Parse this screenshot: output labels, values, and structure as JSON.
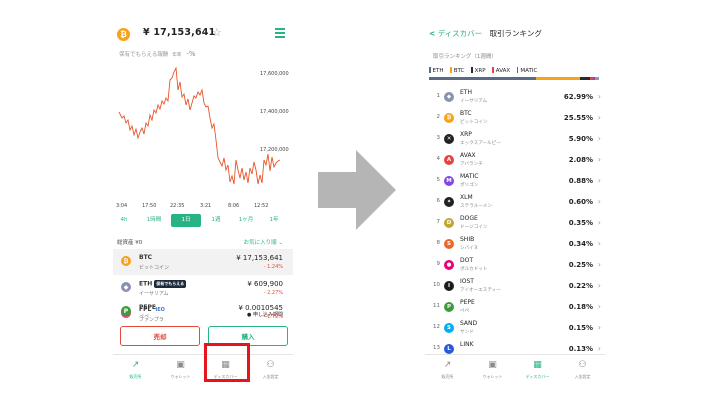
{
  "left": {
    "header": {
      "coin_symbol": "₿",
      "price": "¥ 17,153,641",
      "star": "☆",
      "reward_label": "保有でもらえる報酬",
      "reward_sub": "年率",
      "reward_pct": "-%"
    },
    "chart": {
      "y_labels": [
        "17,600,000",
        "17,400,000",
        "17,200,000"
      ],
      "x_labels": [
        "3:04",
        "17:50",
        "22:35",
        "3:21",
        "8:06",
        "12:52"
      ],
      "color": "#e8542b"
    },
    "timeframes": [
      "4h",
      "1時間",
      "1日",
      "1週",
      "1ヶ月",
      "1年"
    ],
    "active_timeframe": "1日",
    "balance_label": "総資産 ¥0",
    "favorite_label": "お気に入り順 ⌄",
    "assets": [
      {
        "symbol": "BTC",
        "name": "ビットコイン",
        "price": "¥ 17,153,641",
        "change": "- 1.24%",
        "icon": "₿",
        "color": "#f7a21b"
      },
      {
        "symbol": "ETH",
        "tag": "保有でもらえる",
        "name": "イーサリアム",
        "price": "¥ 609,900",
        "change": "- 2.27%",
        "icon": "◆",
        "color": "#8a92b2"
      },
      {
        "symbol": "FPL",
        "ieo": "IEO",
        "name": "ファンプラ",
        "price": "● 申し込み期間",
        "change": "",
        "icon": "F",
        "color": "#e0457b"
      },
      {
        "symbol": "PEPE",
        "name": "ペペ",
        "price": "¥ 0.0010545",
        "change": "- 1.72%",
        "icon": "P",
        "color": "#3e9b3c"
      }
    ],
    "sell_label": "売却",
    "buy_label": "購入"
  },
  "nav": [
    {
      "label": "販売所",
      "icon": "↗"
    },
    {
      "label": "ウォレット",
      "icon": "▣"
    },
    {
      "label": "ディスカバー",
      "icon": "▦"
    },
    {
      "label": "入金設定",
      "icon": "⚇"
    }
  ],
  "right": {
    "back": "<",
    "discover": "ディスカバー",
    "title": "取引ランキング",
    "sub": "取引ランキング（1週間）",
    "legend": [
      {
        "label": "ETH",
        "color": "#5b6b85"
      },
      {
        "label": "BTC",
        "color": "#f7a21b"
      },
      {
        "label": "XRP",
        "color": "#2b2b2b"
      },
      {
        "label": "AVAX",
        "color": "#e84142"
      },
      {
        "label": "MATIC",
        "color": "#8247e5"
      }
    ],
    "share_bar": [
      {
        "pct": 62.99,
        "color": "#5b6b85"
      },
      {
        "pct": 25.55,
        "color": "#f7a21b"
      },
      {
        "pct": 5.9,
        "color": "#2b2b2b"
      },
      {
        "pct": 2.08,
        "color": "#e84142"
      },
      {
        "pct": 0.88,
        "color": "#8247e5"
      },
      {
        "pct": 2.6,
        "color": "#999999"
      }
    ],
    "ranking": [
      {
        "rank": "1",
        "symbol": "ETH",
        "name": "イーサリアム",
        "pct": "62.99%",
        "icon": "◆",
        "color": "#8a92b2"
      },
      {
        "rank": "2",
        "symbol": "BTC",
        "name": "ビットコイン",
        "pct": "25.55%",
        "icon": "₿",
        "color": "#f7a21b"
      },
      {
        "rank": "3",
        "symbol": "XRP",
        "name": "エックスアールピー",
        "pct": "5.90%",
        "icon": "✕",
        "color": "#222222"
      },
      {
        "rank": "4",
        "symbol": "AVAX",
        "name": "アバランチ",
        "pct": "2.08%",
        "icon": "A",
        "color": "#e84142"
      },
      {
        "rank": "5",
        "symbol": "MATIC",
        "name": "ポリゴン",
        "pct": "0.88%",
        "icon": "M",
        "color": "#8247e5"
      },
      {
        "rank": "6",
        "symbol": "XLM",
        "name": "ステラルーメン",
        "pct": "0.60%",
        "icon": "✦",
        "color": "#222222"
      },
      {
        "rank": "7",
        "symbol": "DOGE",
        "name": "ドージコイン",
        "pct": "0.35%",
        "icon": "D",
        "color": "#c3a634"
      },
      {
        "rank": "8",
        "symbol": "SHIB",
        "name": "シバイヌ",
        "pct": "0.34%",
        "icon": "S",
        "color": "#e76a2b"
      },
      {
        "rank": "9",
        "symbol": "DOT",
        "name": "ポルカドット",
        "pct": "0.25%",
        "icon": "●",
        "color": "#e6007a"
      },
      {
        "rank": "10",
        "symbol": "IOST",
        "name": "アイオーエスティー",
        "pct": "0.22%",
        "icon": "I",
        "color": "#1c1c1c"
      },
      {
        "rank": "11",
        "symbol": "PEPE",
        "name": "ペペ",
        "pct": "0.18%",
        "icon": "P",
        "color": "#3e9b3c"
      },
      {
        "rank": "12",
        "symbol": "SAND",
        "name": "サンド",
        "pct": "0.15%",
        "icon": "S",
        "color": "#04adef"
      },
      {
        "rank": "13",
        "symbol": "LINK",
        "name": "",
        "pct": "0.13%",
        "icon": "L",
        "color": "#2a5ada"
      }
    ]
  },
  "colors": {
    "accent": "#27b383",
    "negative": "#e34a3a",
    "highlight": "#e8141c"
  }
}
